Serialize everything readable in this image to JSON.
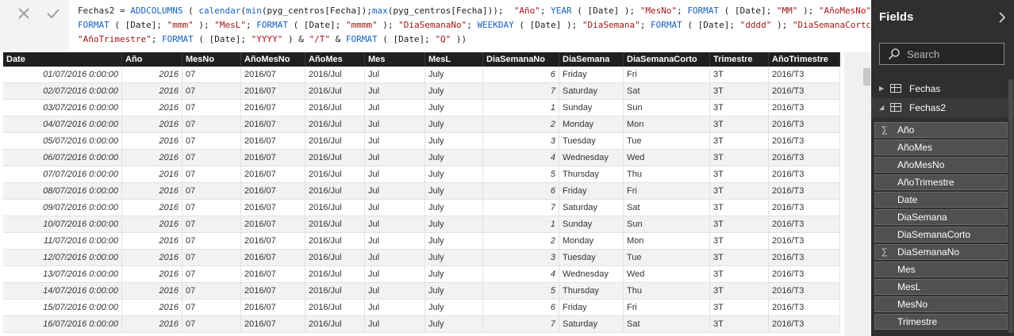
{
  "formula": {
    "lines": [
      [
        {
          "t": "txt",
          "v": "Fechas2 = "
        },
        {
          "t": "fn",
          "v": "ADDCOLUMNS"
        },
        {
          "t": "txt",
          "v": " ( "
        },
        {
          "t": "fn",
          "v": "calendar"
        },
        {
          "t": "txt",
          "v": "("
        },
        {
          "t": "fn",
          "v": "min"
        },
        {
          "t": "txt",
          "v": "(pyg_centros[Fecha]);"
        },
        {
          "t": "fn",
          "v": "max"
        },
        {
          "t": "txt",
          "v": "(pyg_centros[Fecha]));  "
        },
        {
          "t": "str",
          "v": "\"Año\""
        },
        {
          "t": "txt",
          "v": "; "
        },
        {
          "t": "fn",
          "v": "YEAR"
        },
        {
          "t": "txt",
          "v": " ( [Date] ); "
        },
        {
          "t": "str",
          "v": "\"MesNo\""
        },
        {
          "t": "txt",
          "v": "; "
        },
        {
          "t": "fn",
          "v": "FORMAT"
        },
        {
          "t": "txt",
          "v": " ( [Date]; "
        },
        {
          "t": "str",
          "v": "\"MM\""
        },
        {
          "t": "txt",
          "v": " ); "
        },
        {
          "t": "str",
          "v": "\"AñoMesNo\""
        },
        {
          "t": "txt",
          "v": ";"
        }
      ],
      [
        {
          "t": "fn",
          "v": "FORMAT"
        },
        {
          "t": "txt",
          "v": " ( [Date]; "
        },
        {
          "t": "str",
          "v": "\"mmm\""
        },
        {
          "t": "txt",
          "v": " ); "
        },
        {
          "t": "str",
          "v": "\"MesL\""
        },
        {
          "t": "txt",
          "v": "; "
        },
        {
          "t": "fn",
          "v": "FORMAT"
        },
        {
          "t": "txt",
          "v": " ( [Date]; "
        },
        {
          "t": "str",
          "v": "\"mmmm\""
        },
        {
          "t": "txt",
          "v": " ); "
        },
        {
          "t": "str",
          "v": "\"DiaSemanaNo\""
        },
        {
          "t": "txt",
          "v": "; "
        },
        {
          "t": "fn",
          "v": "WEEKDAY"
        },
        {
          "t": "txt",
          "v": " ( [Date] ); "
        },
        {
          "t": "str",
          "v": "\"DiaSemana\""
        },
        {
          "t": "txt",
          "v": "; "
        },
        {
          "t": "fn",
          "v": "FORMAT"
        },
        {
          "t": "txt",
          "v": " ( [Date]; "
        },
        {
          "t": "str",
          "v": "\"dddd\""
        },
        {
          "t": "txt",
          "v": " ); "
        },
        {
          "t": "str",
          "v": "\"DiaSemanaCorto\""
        },
        {
          "t": "txt",
          "v": ";"
        }
      ],
      [
        {
          "t": "str",
          "v": "\"AñoTrimestre\""
        },
        {
          "t": "txt",
          "v": "; "
        },
        {
          "t": "fn",
          "v": "FORMAT"
        },
        {
          "t": "txt",
          "v": " ( [Date]; "
        },
        {
          "t": "str",
          "v": "\"YYYY\""
        },
        {
          "t": "txt",
          "v": " ) & "
        },
        {
          "t": "str",
          "v": "\"/T\""
        },
        {
          "t": "txt",
          "v": " & "
        },
        {
          "t": "fn",
          "v": "FORMAT"
        },
        {
          "t": "txt",
          "v": " ( [Date]; "
        },
        {
          "t": "str",
          "v": "\"Q\""
        },
        {
          "t": "txt",
          "v": " ))"
        }
      ]
    ]
  },
  "table": {
    "columns": [
      {
        "label": "Date",
        "numeric": true
      },
      {
        "label": "Año",
        "numeric": true
      },
      {
        "label": "MesNo",
        "numeric": false
      },
      {
        "label": "AñoMesNo",
        "numeric": false
      },
      {
        "label": "AñoMes",
        "numeric": false
      },
      {
        "label": "Mes",
        "numeric": false
      },
      {
        "label": "MesL",
        "numeric": false
      },
      {
        "label": "DiaSemanaNo",
        "numeric": true
      },
      {
        "label": "DiaSemana",
        "numeric": false
      },
      {
        "label": "DiaSemanaCorto",
        "numeric": false
      },
      {
        "label": "Trimestre",
        "numeric": false
      },
      {
        "label": "AñoTrimestre",
        "numeric": false
      }
    ],
    "rows": [
      [
        "01/07/2016 0:00:00",
        "2016",
        "07",
        "2016/07",
        "2016/Jul",
        "Jul",
        "July",
        "6",
        "Friday",
        "Fri",
        "3T",
        "2016/T3"
      ],
      [
        "02/07/2016 0:00:00",
        "2016",
        "07",
        "2016/07",
        "2016/Jul",
        "Jul",
        "July",
        "7",
        "Saturday",
        "Sat",
        "3T",
        "2016/T3"
      ],
      [
        "03/07/2016 0:00:00",
        "2016",
        "07",
        "2016/07",
        "2016/Jul",
        "Jul",
        "July",
        "1",
        "Sunday",
        "Sun",
        "3T",
        "2016/T3"
      ],
      [
        "04/07/2016 0:00:00",
        "2016",
        "07",
        "2016/07",
        "2016/Jul",
        "Jul",
        "July",
        "2",
        "Monday",
        "Mon",
        "3T",
        "2016/T3"
      ],
      [
        "05/07/2016 0:00:00",
        "2016",
        "07",
        "2016/07",
        "2016/Jul",
        "Jul",
        "July",
        "3",
        "Tuesday",
        "Tue",
        "3T",
        "2016/T3"
      ],
      [
        "06/07/2016 0:00:00",
        "2016",
        "07",
        "2016/07",
        "2016/Jul",
        "Jul",
        "July",
        "4",
        "Wednesday",
        "Wed",
        "3T",
        "2016/T3"
      ],
      [
        "07/07/2016 0:00:00",
        "2016",
        "07",
        "2016/07",
        "2016/Jul",
        "Jul",
        "July",
        "5",
        "Thursday",
        "Thu",
        "3T",
        "2016/T3"
      ],
      [
        "08/07/2016 0:00:00",
        "2016",
        "07",
        "2016/07",
        "2016/Jul",
        "Jul",
        "July",
        "6",
        "Friday",
        "Fri",
        "3T",
        "2016/T3"
      ],
      [
        "09/07/2016 0:00:00",
        "2016",
        "07",
        "2016/07",
        "2016/Jul",
        "Jul",
        "July",
        "7",
        "Saturday",
        "Sat",
        "3T",
        "2016/T3"
      ],
      [
        "10/07/2016 0:00:00",
        "2016",
        "07",
        "2016/07",
        "2016/Jul",
        "Jul",
        "July",
        "1",
        "Sunday",
        "Sun",
        "3T",
        "2016/T3"
      ],
      [
        "11/07/2016 0:00:00",
        "2016",
        "07",
        "2016/07",
        "2016/Jul",
        "Jul",
        "July",
        "2",
        "Monday",
        "Mon",
        "3T",
        "2016/T3"
      ],
      [
        "12/07/2016 0:00:00",
        "2016",
        "07",
        "2016/07",
        "2016/Jul",
        "Jul",
        "July",
        "3",
        "Tuesday",
        "Tue",
        "3T",
        "2016/T3"
      ],
      [
        "13/07/2016 0:00:00",
        "2016",
        "07",
        "2016/07",
        "2016/Jul",
        "Jul",
        "July",
        "4",
        "Wednesday",
        "Wed",
        "3T",
        "2016/T3"
      ],
      [
        "14/07/2016 0:00:00",
        "2016",
        "07",
        "2016/07",
        "2016/Jul",
        "Jul",
        "July",
        "5",
        "Thursday",
        "Thu",
        "3T",
        "2016/T3"
      ],
      [
        "15/07/2016 0:00:00",
        "2016",
        "07",
        "2016/07",
        "2016/Jul",
        "Jul",
        "July",
        "6",
        "Friday",
        "Fri",
        "3T",
        "2016/T3"
      ],
      [
        "16/07/2016 0:00:00",
        "2016",
        "07",
        "2016/07",
        "2016/Jul",
        "Jul",
        "July",
        "7",
        "Saturday",
        "Sat",
        "3T",
        "2016/T3"
      ]
    ]
  },
  "fields_pane": {
    "title": "Fields",
    "search_placeholder": "Search",
    "tables": [
      {
        "name": "Fechas",
        "expanded": false
      },
      {
        "name": "Fechas2",
        "expanded": true
      }
    ],
    "fields": [
      {
        "name": "Año",
        "sigma": true
      },
      {
        "name": "AñoMes",
        "sigma": false
      },
      {
        "name": "AñoMesNo",
        "sigma": false
      },
      {
        "name": "AñoTrimestre",
        "sigma": false
      },
      {
        "name": "Date",
        "sigma": false
      },
      {
        "name": "DiaSemana",
        "sigma": false
      },
      {
        "name": "DiaSemanaCorto",
        "sigma": false
      },
      {
        "name": "DiaSemanaNo",
        "sigma": true
      },
      {
        "name": "Mes",
        "sigma": false
      },
      {
        "name": "MesL",
        "sigma": false
      },
      {
        "name": "MesNo",
        "sigma": false
      },
      {
        "name": "Trimestre",
        "sigma": false
      }
    ]
  },
  "icons": {
    "cancel": "close-x-icon",
    "commit": "checkmark-icon",
    "search": "search-icon",
    "collapse": "chevron-right-icon",
    "table": "table-icon",
    "sigma": "sigma-icon"
  },
  "colors": {
    "header_bg": "#1f1f1f",
    "pane_bg": "#2f2f2f",
    "dax_function": "#1560bd",
    "dax_string": "#a31515"
  }
}
